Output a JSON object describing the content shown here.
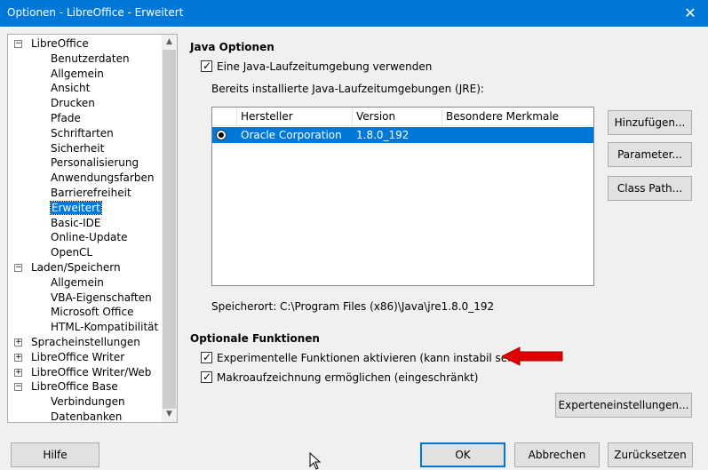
{
  "window": {
    "title": "Optionen - LibreOffice - Erweitert",
    "close_glyph": "✕"
  },
  "tree": {
    "items": [
      {
        "label": "LibreOffice",
        "level": 0,
        "expander": "⊟"
      },
      {
        "label": "Benutzerdaten",
        "level": 1
      },
      {
        "label": "Allgemein",
        "level": 1
      },
      {
        "label": "Ansicht",
        "level": 1
      },
      {
        "label": "Drucken",
        "level": 1
      },
      {
        "label": "Pfade",
        "level": 1
      },
      {
        "label": "Schriftarten",
        "level": 1
      },
      {
        "label": "Sicherheit",
        "level": 1
      },
      {
        "label": "Personalisierung",
        "level": 1
      },
      {
        "label": "Anwendungsfarben",
        "level": 1
      },
      {
        "label": "Barrierefreiheit",
        "level": 1
      },
      {
        "label": "Erweitert",
        "level": 1,
        "selected": true
      },
      {
        "label": "Basic-IDE",
        "level": 1
      },
      {
        "label": "Online-Update",
        "level": 1
      },
      {
        "label": "OpenCL",
        "level": 1
      },
      {
        "label": "Laden/Speichern",
        "level": 0,
        "expander": "⊟"
      },
      {
        "label": "Allgemein",
        "level": 1
      },
      {
        "label": "VBA-Eigenschaften",
        "level": 1
      },
      {
        "label": "Microsoft Office",
        "level": 1
      },
      {
        "label": "HTML-Kompatibilität",
        "level": 1
      },
      {
        "label": "Spracheinstellungen",
        "level": 0,
        "expander": "⊞"
      },
      {
        "label": "LibreOffice Writer",
        "level": 0,
        "expander": "⊞"
      },
      {
        "label": "LibreOffice Writer/Web",
        "level": 0,
        "expander": "⊞"
      },
      {
        "label": "LibreOffice Base",
        "level": 0,
        "expander": "⊟"
      },
      {
        "label": "Verbindungen",
        "level": 1
      },
      {
        "label": "Datenbanken",
        "level": 1
      }
    ]
  },
  "java": {
    "section_title": "Java Optionen",
    "use_jre_label": "Eine Java-Laufzeitumgebung verwenden",
    "use_jre_checked": true,
    "installed_label": "Bereits installierte Java-Laufzeitumgebungen (JRE):",
    "columns": [
      "Hersteller",
      "Version",
      "Besondere Merkmale"
    ],
    "rows": [
      {
        "vendor": "Oracle Corporation",
        "version": "1.8.0_192",
        "features": "",
        "selected": true
      }
    ],
    "location_label": "Speicherort: C:\\Program Files (x86)\\Java\\jre1.8.0_192",
    "buttons": {
      "add": "Hinzufügen...",
      "parameters": "Parameter...",
      "classpath": "Class Path..."
    }
  },
  "optional": {
    "section_title": "Optionale Funktionen",
    "experimental_label": "Experimentelle Funktionen aktivieren (kann instabil sein)",
    "experimental_checked": true,
    "macro_label": "Makroaufzeichnung ermöglichen (eingeschränkt)",
    "macro_checked": true,
    "expert_button": "Experteneinstellungen..."
  },
  "footer": {
    "help": "Hilfe",
    "ok": "OK",
    "cancel": "Abbrechen",
    "reset": "Zurücksetzen"
  },
  "colors": {
    "accent": "#0078d7",
    "annotation_arrow": "#e00000"
  }
}
